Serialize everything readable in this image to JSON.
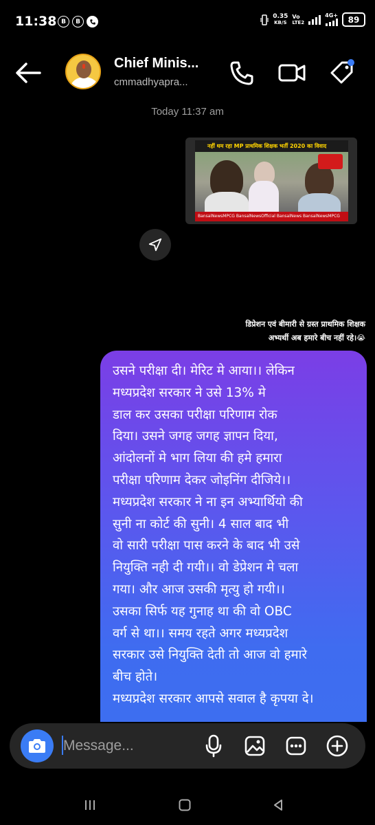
{
  "status_bar": {
    "time": "11:38",
    "left_badges": [
      "B",
      "B"
    ],
    "net_speed_value": "0.35",
    "net_speed_unit": "KB/S",
    "volte_top": "Vo",
    "volte_bottom": "LTE2",
    "network_type": "4G+",
    "battery": "89"
  },
  "header": {
    "contact_name": "Chief Minis...",
    "contact_handle": "cmmadhyapra..."
  },
  "thread": {
    "timestamp": "Today 11:37 am",
    "shared_post": {
      "banner_text": "नहीं थम रहा MP प्राथमिक शिक्षक भर्ती 2020 का विवाद",
      "footer_text": "BansalNewsMPCG   BansalNewsOfficial   BansalNews   BansalNewsMPCG"
    },
    "caption_line1": "डिप्रेशन एवं बीमारी से ग्रस्त प्राथमिक शिक्षक",
    "caption_line2": "अभ्यर्थी अब हमारे बीच नहीं रहे।😭",
    "message_text": "उसने परीक्षा दी। मेरिट मे आया।। लेकिन\nमध्यप्रदेश सरकार ने उसे 13%  मे\nडाल कर उसका परीक्षा परिणाम रोक\nदिया।   उसने जगह जगह ज्ञापन दिया,\nआंदोलनों मे भाग लिया की हमे हमारा\nपरीक्षा परिणाम देकर जोइनिंग दीजिये।।\nमध्यप्रदेश सरकार ने ना इन अभ्यार्थियो की\nसुनी ना कोर्ट की सुनी। 4 साल बाद भी\nवो सारी परीक्षा पास करने के बाद भी उसे\nनियुक्ति नही दी गयी।। वो डेप्रेशन मे चला\nगया। और आज उसकी मृत्यु हो गयी।।\nउसका सिर्फ यह गुनाह था की वो OBC\nवर्ग से था।।  समय रहते अगर मध्यप्रदेश\nसरकार उसे नियुक्ति देती तो आज वो हमारे\nबीच होते।\nमध्यप्रदेश सरकार आपसे सवाल है कृपया दे।"
  },
  "composer": {
    "placeholder": "Message..."
  },
  "colors": {
    "bubble_top": "#7b3ee6",
    "bubble_bottom": "#3d6ef0",
    "camera": "#3a7cf5",
    "badge_dot": "#3a7cf5"
  },
  "icons": {
    "header": [
      "back-arrow-icon",
      "phone-icon",
      "video-camera-icon",
      "tag-icon"
    ],
    "composer": [
      "camera-icon",
      "microphone-icon",
      "image-icon",
      "sticker-icon",
      "plus-icon"
    ],
    "nav": [
      "recents-icon",
      "home-icon",
      "back-icon"
    ]
  }
}
